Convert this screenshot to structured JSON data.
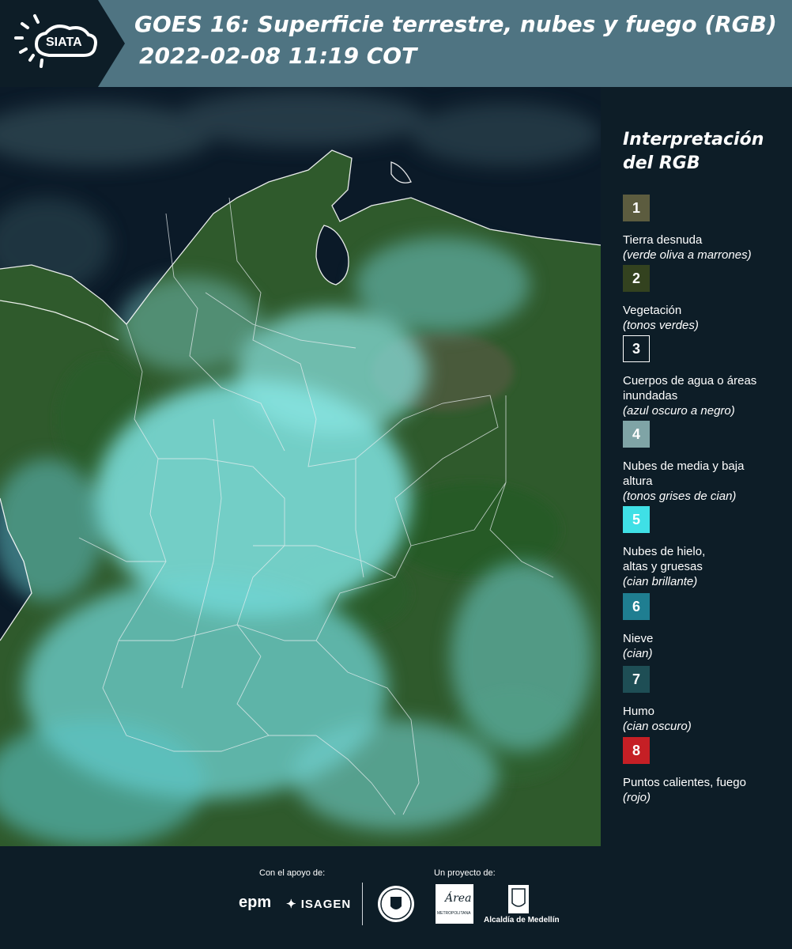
{
  "header": {
    "logo_text": "SIATA",
    "title_line1": "GOES 16: Superficie terrestre, nubes y fuego (RGB)",
    "title_line2": "2022-02-08 11:19 COT"
  },
  "legend": {
    "title_line1": "Interpretación",
    "title_line2": "del RGB",
    "items": [
      {
        "num": "1",
        "color": "#5c5c3f",
        "label": "Tierra desnuda",
        "sub": "(verde oliva a marrones)"
      },
      {
        "num": "2",
        "color": "#33421f",
        "label": "Vegetación",
        "sub": "(tonos verdes)"
      },
      {
        "num": "3",
        "color": "#0d1d27",
        "label": "Cuerpos de agua o áreas inundadas",
        "sub": "(azul oscuro a negro)"
      },
      {
        "num": "4",
        "color": "#7fa4a6",
        "label": "Nubes de media y baja altura",
        "sub": "(tonos grises de cian)"
      },
      {
        "num": "5",
        "color": "#3fe0e6",
        "label": "Nubes de hielo, altas y gruesas",
        "sub": "(cian brillante)"
      },
      {
        "num": "6",
        "color": "#1f7e91",
        "label": "Nieve",
        "sub": "(cian)"
      },
      {
        "num": "7",
        "color": "#1e4e55",
        "label": "Humo",
        "sub": "(cian oscuro)"
      },
      {
        "num": "8",
        "color": "#c51f25",
        "label": "Puntos calientes, fuego",
        "sub": "(rojo)"
      }
    ]
  },
  "footer": {
    "support_label": "Con el apoyo de:",
    "project_label": "Un proyecto de:",
    "epm": "epm",
    "isagen": "ISAGEN",
    "area_metro": "Área",
    "area_metro_sub": "METROPOLITANA",
    "alcaldia": "Alcaldía de Medellín"
  },
  "colors": {
    "header_bg": "#4f7482",
    "page_bg": "#0d1d27",
    "vegetation": "#2f5a2c",
    "cloud_cyan": "#7fe3e2",
    "water": "#0b1a28"
  }
}
